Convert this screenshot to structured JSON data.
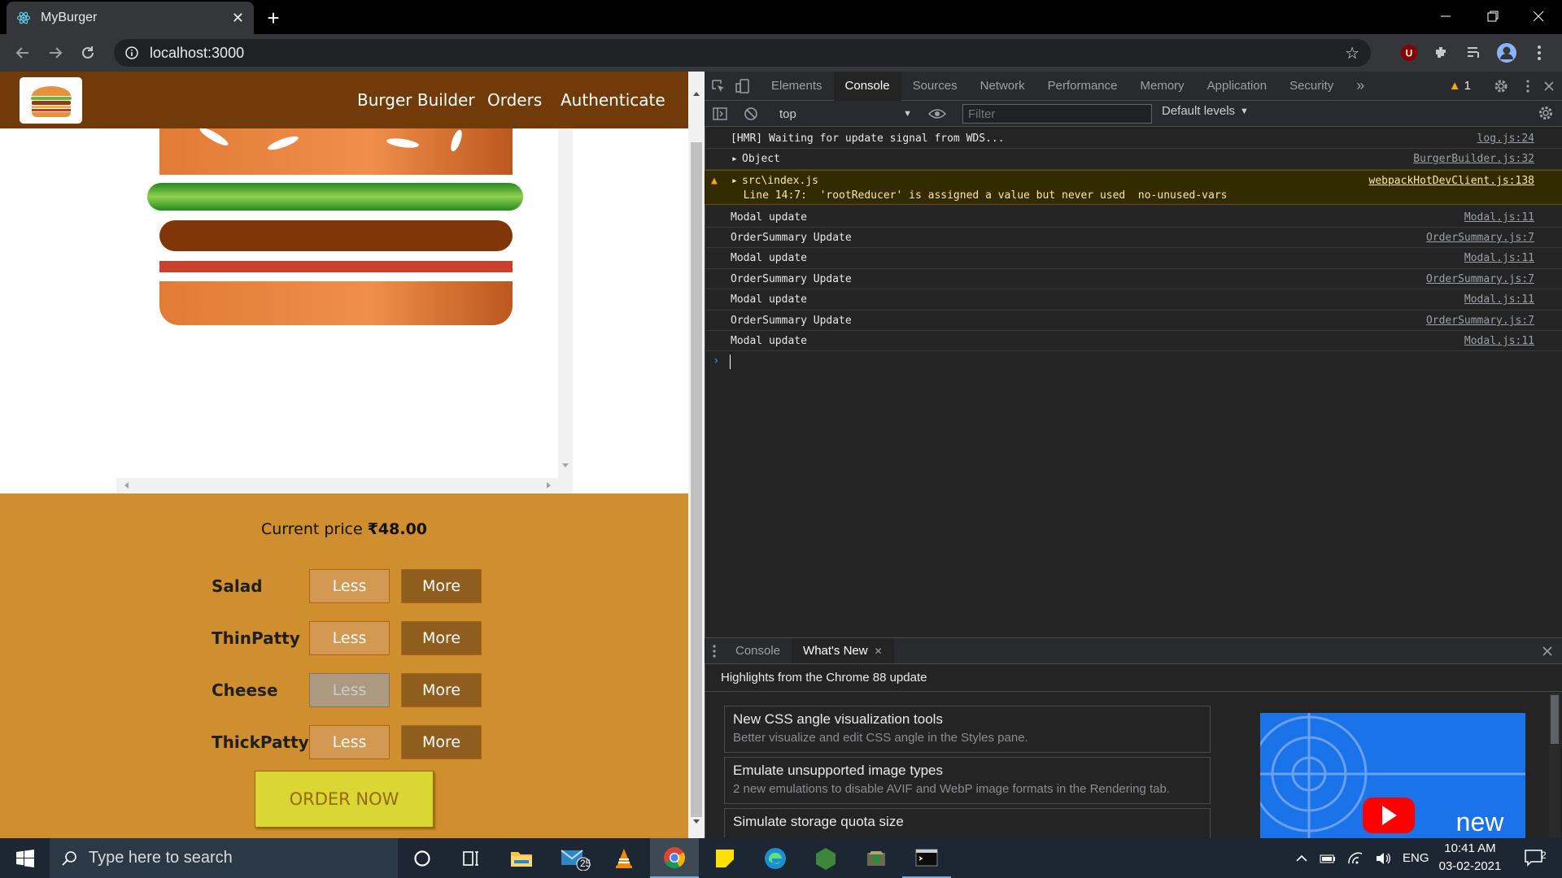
{
  "browser": {
    "tab_title": "MyBurger",
    "url": "localhost:3000"
  },
  "app": {
    "nav": [
      "Burger Builder",
      "Orders",
      "Authenticate"
    ],
    "price_label": "Current price",
    "price_value": "₹48.00",
    "controls": [
      {
        "label": "Salad",
        "less": "Less",
        "more": "More",
        "less_disabled": false
      },
      {
        "label": "ThinPatty",
        "less": "Less",
        "more": "More",
        "less_disabled": false
      },
      {
        "label": "Cheese",
        "less": "Less",
        "more": "More",
        "less_disabled": true
      },
      {
        "label": "ThickPatty",
        "less": "Less",
        "more": "More",
        "less_disabled": false
      }
    ],
    "order_button": "ORDER NOW"
  },
  "devtools": {
    "tabs": [
      "Elements",
      "Console",
      "Sources",
      "Network",
      "Performance",
      "Memory",
      "Application",
      "Security"
    ],
    "active_tab": "Console",
    "warning_count": "1",
    "context": "top",
    "filter_placeholder": "Filter",
    "levels": "Default levels",
    "logs": [
      {
        "msg": "[HMR] Waiting for update signal from WDS...",
        "src": "log.js:24"
      },
      {
        "msg": "Object",
        "src": "BurgerBuilder.js:32"
      },
      {
        "msg": "src\\index.js",
        "msg2": "  Line 14:7:  'rootReducer' is assigned a value but never used  no-unused-vars",
        "src": "webpackHotDevClient.js:138",
        "level": "warning"
      },
      {
        "msg": "Modal update",
        "src": "Modal.js:11"
      },
      {
        "msg": "OrderSummary Update",
        "src": "OrderSummary.js:7"
      },
      {
        "msg": "Modal update",
        "src": "Modal.js:11"
      },
      {
        "msg": "OrderSummary Update",
        "src": "OrderSummary.js:7"
      },
      {
        "msg": "Modal update",
        "src": "Modal.js:11"
      },
      {
        "msg": "OrderSummary Update",
        "src": "OrderSummary.js:7"
      },
      {
        "msg": "Modal update",
        "src": "Modal.js:11"
      }
    ],
    "drawer": {
      "tabs": [
        "Console",
        "What's New"
      ],
      "heading": "Highlights from the Chrome 88 update",
      "items": [
        {
          "title": "New CSS angle visualization tools",
          "desc": "Better visualize and edit CSS angle in the Styles pane."
        },
        {
          "title": "Emulate unsupported image types",
          "desc": "2 new emulations to disable AVIF and WebP image formats in the Rendering tab."
        },
        {
          "title": "Simulate storage quota size",
          "desc": ""
        }
      ],
      "image_text": "new"
    }
  },
  "taskbar": {
    "search_placeholder": "Type here to search",
    "mail_badge": "25",
    "language": "ENG",
    "time": "10:41 AM",
    "date": "03-02-2021",
    "notification_count": "2"
  },
  "colors": {
    "nav": "#703b09",
    "controls_bg": "#cf8f2e",
    "order_button": "#dad735"
  }
}
